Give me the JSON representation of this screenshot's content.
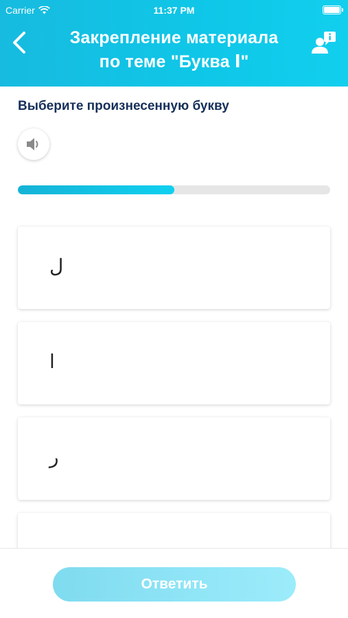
{
  "status_bar": {
    "carrier": "Carrier",
    "time": "11:37 PM"
  },
  "header": {
    "title_line1": "Закрепление материала",
    "title_line2": "по теме  \"Буква ا\""
  },
  "task": {
    "prompt": "Выберите произнесенную букву"
  },
  "progress": {
    "fraction": 0.5
  },
  "options": [
    {
      "letter": "ل"
    },
    {
      "letter": "ا"
    },
    {
      "letter": "ر"
    },
    {
      "letter": ""
    }
  ],
  "footer": {
    "submit_label": "Ответить"
  },
  "colors": {
    "header_start": "#17bbdf",
    "header_end": "#12cfee",
    "prompt_text": "#16305a",
    "button_disabled": "#9cecfb"
  },
  "icons": {
    "back": "chevron-left-icon",
    "info": "person-info-icon",
    "speaker": "speaker-icon",
    "wifi": "wifi-icon",
    "battery": "battery-icon"
  }
}
